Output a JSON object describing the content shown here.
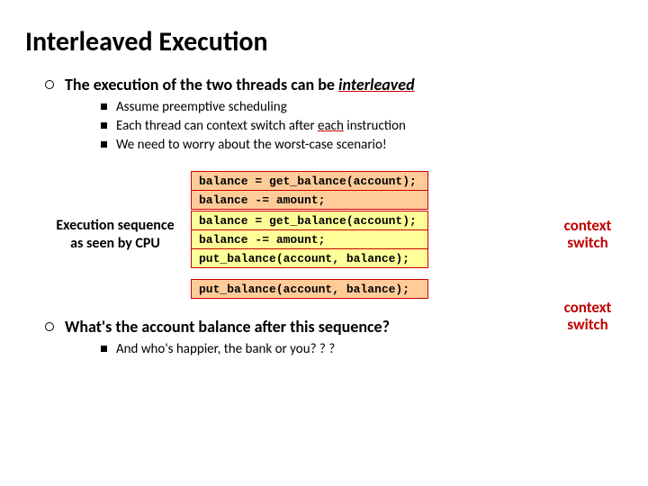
{
  "title": "Interleaved Execution",
  "bullet1": {
    "prefix": "The execution of the two threads can be ",
    "emph": "interleaved"
  },
  "subs": [
    "Assume preemptive scheduling",
    {
      "pre": "Each thread can context switch after ",
      "u": "each",
      "post": " instruction"
    },
    "We need to worry about the worst-case scenario!"
  ],
  "exec_label": "Execution sequence as seen by CPU",
  "code": {
    "g1": [
      "balance = get_balance(account);",
      "balance -= amount;"
    ],
    "g2": [
      "balance = get_balance(account);",
      "balance -= amount;",
      "put_balance(account, balance);"
    ],
    "g3": [
      "put_balance(account, balance);"
    ]
  },
  "switch_label": "context switch",
  "bullet2": "What's the account balance after this sequence?",
  "sub2": "And who's happier, the bank or you? ? ?"
}
